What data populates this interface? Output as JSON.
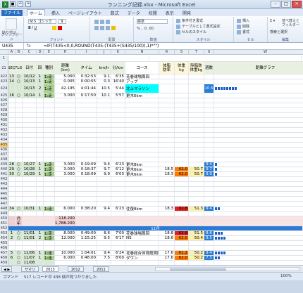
{
  "window": {
    "title": "ランニング記録.xlsx - Microsoft Excel",
    "app_letter": "X"
  },
  "tabs": [
    "ファイル",
    "ホーム",
    "挿入",
    "ページレイアウト",
    "数式",
    "データ",
    "校閲",
    "表示",
    "開発"
  ],
  "ribbon": {
    "paste": "貼り付け",
    "clipboard": "クリップボード",
    "font": "フォント",
    "font_name": "ＭＳ ゴシック",
    "font_size": "9",
    "alignment": "配置",
    "number": "数値",
    "number_format": "標準",
    "cond_format": "条件付き書式",
    "table_format": "テーブルとして書式設定",
    "cell_style": "セルのスタイル",
    "styles": "スタイル",
    "insert": "挿入",
    "delete": "削除",
    "format": "書式",
    "cells": "セル",
    "sort": "並べ替えと\nフィルター",
    "find": "検索と選択",
    "edit": "編集"
  },
  "formula_bar": {
    "name_box": "U435",
    "fx": "fx",
    "formula": "=IF(T435<0,0,ROUND(T435-(T435+(S435/100)),1)*\"\")"
  },
  "columns": [
    "A",
    "B",
    "C",
    "D",
    "E",
    "F",
    "G",
    "H",
    "I",
    "J",
    "K",
    "L",
    "M",
    "N",
    "O",
    "P",
    "Q",
    "R",
    "S",
    "T",
    "U",
    "V",
    "W"
  ],
  "header_rows": {
    "r1": "ランニング記録表: 2013",
    "version": "Ver 1.01",
    "heads": [
      "SEQ",
      "FLG",
      "日付",
      "回",
      "種別",
      "距離\n(km)",
      "タイム",
      "km/h",
      "分/km",
      "コース",
      "体脂\n肪率",
      "体重\nkg",
      "除脂肪\n体重kg",
      "週数",
      "距離グラフ"
    ]
  },
  "rows": [
    {
      "n": "422",
      "seq": "13",
      "flg": "○",
      "date": "10/12",
      "k": "1",
      "type": "1:走",
      "dist": "5.000",
      "time": "0:32:53",
      "kmh": "9.1",
      "pace": "6'35",
      "course": "花巻球場周回",
      "bf": "",
      "wt": "",
      "lbm": "",
      "wk": "",
      "bars": 0,
      "dcls": "lg"
    },
    {
      "n": "423",
      "seq": "14",
      "flg": "○",
      "date": "10/13",
      "k": "1",
      "type": "1:走",
      "dist": "0.005",
      "time": "0:00:55",
      "kmh": "0.3",
      "pace": "16'40",
      "course": "アップ",
      "bf": "",
      "wt": "",
      "lbm": "",
      "wk": "",
      "bars": 0,
      "dcls": "lg"
    },
    {
      "n": "424",
      "seq": "",
      "flg": "",
      "date": "10/13",
      "k": "2",
      "type": "1:走",
      "dist": "42.195",
      "time": "4:01:44",
      "kmh": "10.5",
      "pace": "5'44",
      "course": "北上マラソン",
      "bf": "",
      "wt": "",
      "lbm": "",
      "wk": "10.5",
      "bars": 8,
      "dcls": "lg",
      "ccls": "cy",
      "tall": true
    },
    {
      "n": "425",
      "seq": "16",
      "flg": "○",
      "date": "10/14",
      "k": "1",
      "type": "1:走",
      "dist": "3.000",
      "time": "0:17:50",
      "kmh": "10.1",
      "pace": "5'57",
      "course": "更木6km",
      "bf": "",
      "wt": "",
      "lbm": "",
      "wk": "",
      "bars": 0,
      "dcls": "lg"
    },
    {
      "n": "426",
      "seq": "",
      "flg": "",
      "date": "",
      "k": "",
      "type": "",
      "dist": "",
      "time": "",
      "kmh": "",
      "pace": "",
      "course": "",
      "bf": "",
      "wt": "",
      "lbm": "",
      "wk": "",
      "bars": 0
    },
    {
      "n": "427",
      "seq": "",
      "flg": "",
      "date": "",
      "k": "",
      "type": "",
      "dist": "",
      "time": "",
      "kmh": "",
      "pace": "",
      "course": "",
      "bf": "",
      "wt": "",
      "lbm": "",
      "wk": "",
      "bars": 0
    },
    {
      "n": "428",
      "seq": "",
      "flg": "",
      "date": "",
      "k": "",
      "type": "",
      "dist": "",
      "time": "",
      "kmh": "",
      "pace": "",
      "course": "",
      "bf": "",
      "wt": "",
      "lbm": "",
      "wk": "",
      "bars": 0
    },
    {
      "n": "429",
      "seq": "",
      "flg": "",
      "date": "",
      "k": "",
      "type": "",
      "dist": "",
      "time": "",
      "kmh": "",
      "pace": "",
      "course": "",
      "bf": "",
      "wt": "",
      "lbm": "",
      "wk": "",
      "bars": 0
    },
    {
      "n": "430",
      "seq": "",
      "flg": "",
      "date": "",
      "k": "",
      "type": "",
      "dist": "",
      "time": "",
      "kmh": "",
      "pace": "",
      "course": "",
      "bf": "",
      "wt": "",
      "lbm": "",
      "wk": "",
      "bars": 0
    },
    {
      "n": "431",
      "seq": "",
      "flg": "",
      "date": "",
      "k": "",
      "type": "",
      "dist": "",
      "time": "",
      "kmh": "",
      "pace": "",
      "course": "",
      "bf": "",
      "wt": "",
      "lbm": "",
      "wk": "",
      "bars": 0
    },
    {
      "n": "432",
      "seq": "",
      "flg": "",
      "date": "",
      "k": "",
      "type": "",
      "dist": "",
      "time": "",
      "kmh": "",
      "pace": "",
      "course": "",
      "bf": "",
      "wt": "",
      "lbm": "",
      "wk": "",
      "bars": 0
    },
    {
      "n": "433",
      "seq": "",
      "flg": "",
      "date": "",
      "k": "",
      "type": "",
      "dist": "",
      "time": "",
      "kmh": "",
      "pace": "",
      "course": "",
      "bf": "",
      "wt": "",
      "lbm": "",
      "wk": "",
      "bars": 0
    },
    {
      "n": "434",
      "seq": "",
      "flg": "",
      "date": "",
      "k": "",
      "type": "",
      "dist": "",
      "time": "",
      "kmh": "",
      "pace": "",
      "course": "",
      "bf": "",
      "wt": "",
      "lbm": "",
      "wk": "",
      "bars": 0
    },
    {
      "n": "435",
      "seq": "",
      "flg": "",
      "date": "",
      "k": "",
      "type": "",
      "dist": "",
      "time": "",
      "kmh": "",
      "pace": "",
      "course": "",
      "bf": "",
      "wt": "",
      "lbm": "",
      "wk": "",
      "bars": 0,
      "sel": true
    },
    {
      "n": "436",
      "seq": "",
      "flg": "",
      "date": "",
      "k": "",
      "type": "",
      "dist": "",
      "time": "",
      "kmh": "",
      "pace": "",
      "course": "",
      "bf": "",
      "wt": "",
      "lbm": "",
      "wk": "",
      "bars": 0
    },
    {
      "n": "437",
      "seq": "",
      "flg": "",
      "date": "",
      "k": "",
      "type": "",
      "dist": "",
      "time": "",
      "kmh": "",
      "pace": "",
      "course": "",
      "bf": "",
      "wt": "",
      "lbm": "",
      "wk": "",
      "bars": 0
    },
    {
      "n": "438",
      "seq": "",
      "flg": "",
      "date": "",
      "k": "",
      "type": "",
      "dist": "",
      "time": "",
      "kmh": "",
      "pace": "",
      "course": "",
      "bf": "",
      "wt": "",
      "lbm": "",
      "wk": "",
      "bars": 0
    },
    {
      "n": "439",
      "seq": "28",
      "flg": "○",
      "date": "10/27",
      "k": "1",
      "type": "1:走",
      "dist": "3.000",
      "time": "0:19:09",
      "kmh": "9.4",
      "pace": "6'23",
      "course": "更木8km",
      "bf": "",
      "wt": "",
      "lbm": "",
      "wk": "9.4",
      "bars": 1,
      "dcls": "lg"
    },
    {
      "n": "440",
      "seq": "29",
      "flg": "○",
      "date": "10/28",
      "k": "1",
      "type": "1:走",
      "dist": "3.000",
      "time": "0:18:37",
      "kmh": "9.7",
      "pace": "6'12",
      "course": "更木6km",
      "bf": "18.5",
      "wt": "62.0",
      "lbm": "50.7",
      "wk": "9.7",
      "bars": 1,
      "dcls": "lg"
    },
    {
      "n": "441",
      "seq": "30",
      "flg": "○",
      "date": "10/29",
      "k": "1",
      "type": "1:走",
      "dist": "3.000",
      "time": "0:18:09",
      "kmh": "9.9",
      "pace": "6'03",
      "course": "更木6km",
      "bf": "18.3",
      "wt": "62.0",
      "lbm": "50.7",
      "wk": "9.9",
      "bars": 1,
      "dcls": "lg"
    },
    {
      "n": "442",
      "seq": "",
      "flg": "",
      "date": "",
      "k": "",
      "type": "",
      "dist": "",
      "time": "",
      "kmh": "",
      "pace": "",
      "course": "",
      "bf": "",
      "wt": "",
      "lbm": "",
      "wk": "",
      "bars": 0
    },
    {
      "n": "443",
      "seq": "",
      "flg": "",
      "date": "",
      "k": "",
      "type": "",
      "dist": "",
      "time": "",
      "kmh": "",
      "pace": "",
      "course": "",
      "bf": "",
      "wt": "",
      "lbm": "",
      "wk": "",
      "bars": 0
    },
    {
      "n": "444",
      "seq": "",
      "flg": "",
      "date": "",
      "k": "",
      "type": "",
      "dist": "",
      "time": "",
      "kmh": "",
      "pace": "",
      "course": "",
      "bf": "",
      "wt": "",
      "lbm": "",
      "wk": "",
      "bars": 0
    },
    {
      "n": "445",
      "seq": "",
      "flg": "",
      "date": "",
      "k": "",
      "type": "",
      "dist": "",
      "time": "",
      "kmh": "",
      "pace": "",
      "course": "",
      "bf": "",
      "wt": "",
      "lbm": "",
      "wk": "",
      "bars": 0
    },
    {
      "n": "446",
      "seq": "",
      "flg": "",
      "date": "",
      "k": "",
      "type": "",
      "dist": "",
      "time": "",
      "kmh": "",
      "pace": "",
      "course": "",
      "bf": "",
      "wt": "",
      "lbm": "",
      "wk": "",
      "bars": 0
    },
    {
      "n": "447",
      "seq": "",
      "flg": "",
      "date": "",
      "k": "",
      "type": "",
      "dist": "",
      "time": "",
      "kmh": "",
      "pace": "",
      "course": "",
      "bf": "",
      "wt": "",
      "lbm": "",
      "wk": "",
      "bars": 0
    },
    {
      "n": "448",
      "seq": "34",
      "flg": "○",
      "date": "10/31",
      "k": "1",
      "type": "1:走",
      "dist": "6.000",
      "time": "0:38:20",
      "kmh": "9.4",
      "pace": "6'23",
      "course": "往復8km",
      "bf": "18.3",
      "wt": "62.8",
      "lbm": "51.3",
      "wk": "9.4",
      "bars": 2,
      "dcls": "lg"
    },
    {
      "n": "449",
      "seq": "",
      "flg": "",
      "date": "",
      "k": "",
      "type": "",
      "dist": "",
      "time": "",
      "kmh": "",
      "pace": "",
      "course": "",
      "bf": "",
      "wt": "",
      "lbm": "",
      "wk": "",
      "bars": 0
    },
    {
      "n": "450",
      "seq": "",
      "flg": "月",
      "date": "",
      "k": "",
      "type": "",
      "dist": "118.200",
      "time": "",
      "kmh": "",
      "pace": "",
      "course": "",
      "bf": "",
      "wt": "",
      "lbm": "",
      "wk": "",
      "bars": 0,
      "sum": true
    },
    {
      "n": "451",
      "seq": "",
      "flg": "年",
      "date": "",
      "k": "",
      "type": "",
      "dist": "1,788.200",
      "time": "",
      "kmh": "",
      "pace": "",
      "course": "",
      "bf": "",
      "wt": "",
      "lbm": "",
      "wk": "",
      "bars": 0,
      "sum": true
    },
    {
      "n": "452",
      "month": "11月"
    },
    {
      "n": "453",
      "seq": "1",
      "flg": "○",
      "date": "11/01",
      "k": "1",
      "type": "1:走",
      "dist": "8.000",
      "time": "0:49:00",
      "kmh": "8.6",
      "pace": "7'00",
      "course": "花巻球場周回",
      "bf": "18.8",
      "wt": "62.8",
      "lbm": "51.5",
      "wk": "8.6",
      "bars": 3,
      "dcls": "lg"
    },
    {
      "n": "454",
      "seq": "2",
      "flg": "○",
      "date": "11/01",
      "k": "2",
      "type": "1:走",
      "dist": "12.000",
      "time": "1:15:25",
      "kmh": "9.5",
      "pace": "6'17",
      "course": "NS",
      "bf": "18.6",
      "wt": "62.0",
      "lbm": "50.4",
      "wk": "9.5",
      "bars": 4,
      "dcls": "lg"
    },
    {
      "n": "455",
      "seq": "",
      "flg": "",
      "date": "",
      "k": "",
      "type": "",
      "dist": "",
      "time": "",
      "kmh": "",
      "pace": "",
      "course": "",
      "bf": "",
      "wt": "",
      "lbm": "",
      "wk": "",
      "bars": 0
    },
    {
      "n": "456",
      "seq": "",
      "flg": "",
      "date": "",
      "k": "",
      "type": "",
      "dist": "",
      "time": "",
      "kmh": "",
      "pace": "",
      "course": "",
      "bf": "",
      "wt": "",
      "lbm": "",
      "wk": "",
      "bars": 0
    },
    {
      "n": "457",
      "seq": "5",
      "flg": "○",
      "date": "11/06",
      "k": "1",
      "type": "1:走",
      "dist": "10.000",
      "time": "1:04:01",
      "kmh": "9.4",
      "pace": "6'24",
      "course": "花巻総合体育館周回",
      "bf": "17.6",
      "wt": "61.2",
      "lbm": "50.2",
      "wk": "9.4",
      "bars": 4,
      "dcls": "lg"
    },
    {
      "n": "458",
      "seq": "6",
      "flg": "○",
      "date": "11/07",
      "k": "1",
      "type": "1:走",
      "dist": "6.000",
      "time": "0:48:00",
      "kmh": "7.5",
      "pace": "8'00",
      "course": "ダウン",
      "bf": "17.6",
      "wt": "62.0",
      "lbm": "50.2",
      "wk": "7.5",
      "bars": 2,
      "dcls": "lg"
    },
    {
      "n": "459",
      "seq": "",
      "flg": "○",
      "date": "11/08",
      "k": "",
      "type": "",
      "dist": "",
      "time": "",
      "kmh": "",
      "pace": "",
      "course": "",
      "bf": "",
      "wt": "",
      "lbm": "",
      "wk": "",
      "bars": 0
    },
    {
      "n": "460",
      "seq": "",
      "flg": "○",
      "date": "11/09",
      "k": "",
      "type": "",
      "dist": "",
      "time": "",
      "kmh": "",
      "pace": "",
      "course": "",
      "bf": "",
      "wt": "",
      "lbm": "",
      "wk": "",
      "bars": 0
    },
    {
      "n": "461",
      "seq": "",
      "flg": "",
      "date": "",
      "k": "",
      "type": "",
      "dist": "",
      "time": "",
      "kmh": "",
      "pace": "",
      "course": "",
      "bf": "",
      "wt": "",
      "lbm": "",
      "wk": "",
      "bars": 0
    },
    {
      "n": "462",
      "seq": "",
      "flg": "",
      "date": "",
      "k": "",
      "type": "",
      "dist": "",
      "time": "",
      "kmh": "",
      "pace": "",
      "course": "",
      "bf": "",
      "wt": "",
      "lbm": "",
      "wk": "",
      "bars": 0
    }
  ],
  "sheets": [
    "サマリ",
    "2013",
    "2012",
    "2011"
  ],
  "status": {
    "mode": "コマンド",
    "info": "517 レコード中 438 個が見つかりました",
    "zoom": "100%"
  }
}
